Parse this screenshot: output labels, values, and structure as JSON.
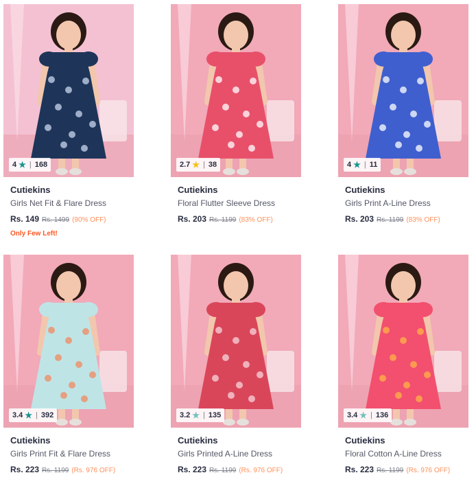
{
  "products": [
    {
      "brand": "Cutiekins",
      "name": "Girls Net Fit & Flare Dress",
      "price": "Rs. 149",
      "mrp": "Rs. 1499",
      "discount": "(90% OFF)",
      "rating": "4",
      "rating_count": "168",
      "star_color": "#14958f",
      "alert": "Only Few Left!",
      "dress_color": "#1e3559",
      "pattern_color": "#c9d6ee",
      "bg_color": "#f4c1d3"
    },
    {
      "brand": "Cutiekins",
      "name": "Floral Flutter Sleeve Dress",
      "price": "Rs. 203",
      "mrp": "Rs. 1199",
      "discount": "(83% OFF)",
      "rating": "2.7",
      "rating_count": "38",
      "star_color": "#f2c210",
      "alert": "",
      "dress_color": "#e8506a",
      "pattern_color": "#ffffff",
      "bg_color": "#f2a9b8"
    },
    {
      "brand": "Cutiekins",
      "name": "Girls Print A-Line Dress",
      "price": "Rs. 203",
      "mrp": "Rs. 1199",
      "discount": "(83% OFF)",
      "rating": "4",
      "rating_count": "11",
      "star_color": "#14958f",
      "alert": "",
      "dress_color": "#3f5fcf",
      "pattern_color": "#ffffff",
      "bg_color": "#f2a9b8"
    },
    {
      "brand": "Cutiekins",
      "name": "Girls Print Fit & Flare Dress",
      "price": "Rs. 223",
      "mrp": "Rs. 1199",
      "discount": "(Rs. 976 OFF)",
      "rating": "3.4",
      "rating_count": "392",
      "star_color": "#14958f",
      "alert": "",
      "dress_color": "#bfe4e6",
      "pattern_color": "#f08a5d",
      "bg_color": "#f2a9b8"
    },
    {
      "brand": "Cutiekins",
      "name": "Girls Printed A-Line Dress",
      "price": "Rs. 223",
      "mrp": "Rs. 1199",
      "discount": "(Rs. 976 OFF)",
      "rating": "3.2",
      "rating_count": "135",
      "star_color": "#72bfbc",
      "alert": "",
      "dress_color": "#d9465a",
      "pattern_color": "#f7d6dc",
      "bg_color": "#f2a9b8"
    },
    {
      "brand": "Cutiekins",
      "name": "Floral Cotton A-Line Dress",
      "price": "Rs. 223",
      "mrp": "Rs. 1199",
      "discount": "(Rs. 976 OFF)",
      "rating": "3.4",
      "rating_count": "136",
      "star_color": "#72bfbc",
      "alert": "",
      "dress_color": "#f2506e",
      "pattern_color": "#ffb347",
      "bg_color": "#f2a9b8"
    }
  ]
}
